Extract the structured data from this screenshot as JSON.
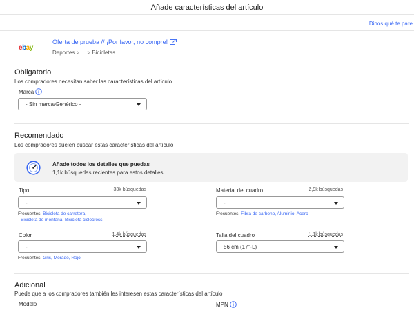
{
  "header": {
    "title": "Añade características del artículo",
    "feedback_link": "Dinos qué te pare"
  },
  "item": {
    "logo_letters": [
      "e",
      "b",
      "a",
      "y"
    ],
    "title": "Oferta de prueba // ¡Por favor, no compre!",
    "breadcrumb": "Deportes  >  ...  >  Bicicletas"
  },
  "required": {
    "title": "Obligatorio",
    "description": "Los compradores necesitan saber las características del artículo",
    "brand": {
      "label": "Marca",
      "value": "- Sin marca/Genérico -"
    }
  },
  "recommended": {
    "title": "Recomendado",
    "description": "Los compradores suelen buscar estas características del artículo",
    "banner": {
      "title": "Añade todos los detalles que puedas",
      "subtitle": "1,1k búsquedas recientes para estos detalles"
    },
    "fields": {
      "tipo": {
        "label": "Tipo",
        "searches": "33k búsquedas",
        "value": "-",
        "frequent_label": "Frecuentes:",
        "frequent_line1": "Bicicleta de carretera,",
        "frequent_line2": "Bicicleta de montaña, Bicicleta ciclocross"
      },
      "material": {
        "label": "Material del cuadro",
        "searches": "2,9k búsquedas",
        "value": "-",
        "frequent_label": "Frecuentes:",
        "frequent_line1": "Fibra de carbono, Aluminio, Acero"
      },
      "color": {
        "label": "Color",
        "searches": "1,4k búsquedas",
        "value": "-",
        "frequent_label": "Frecuentes:",
        "frequent_line1": "Gris, Morado, Rojo"
      },
      "talla": {
        "label": "Talla del cuadro",
        "searches": "1,1k búsquedas",
        "value": "56 cm (17\"-L)"
      }
    }
  },
  "additional": {
    "title": "Adicional",
    "description": "Puede que a los compradores también les interesen estas características del artículo",
    "fields": {
      "modelo": {
        "label": "Modelo"
      },
      "mpn": {
        "label": "MPN"
      }
    }
  }
}
